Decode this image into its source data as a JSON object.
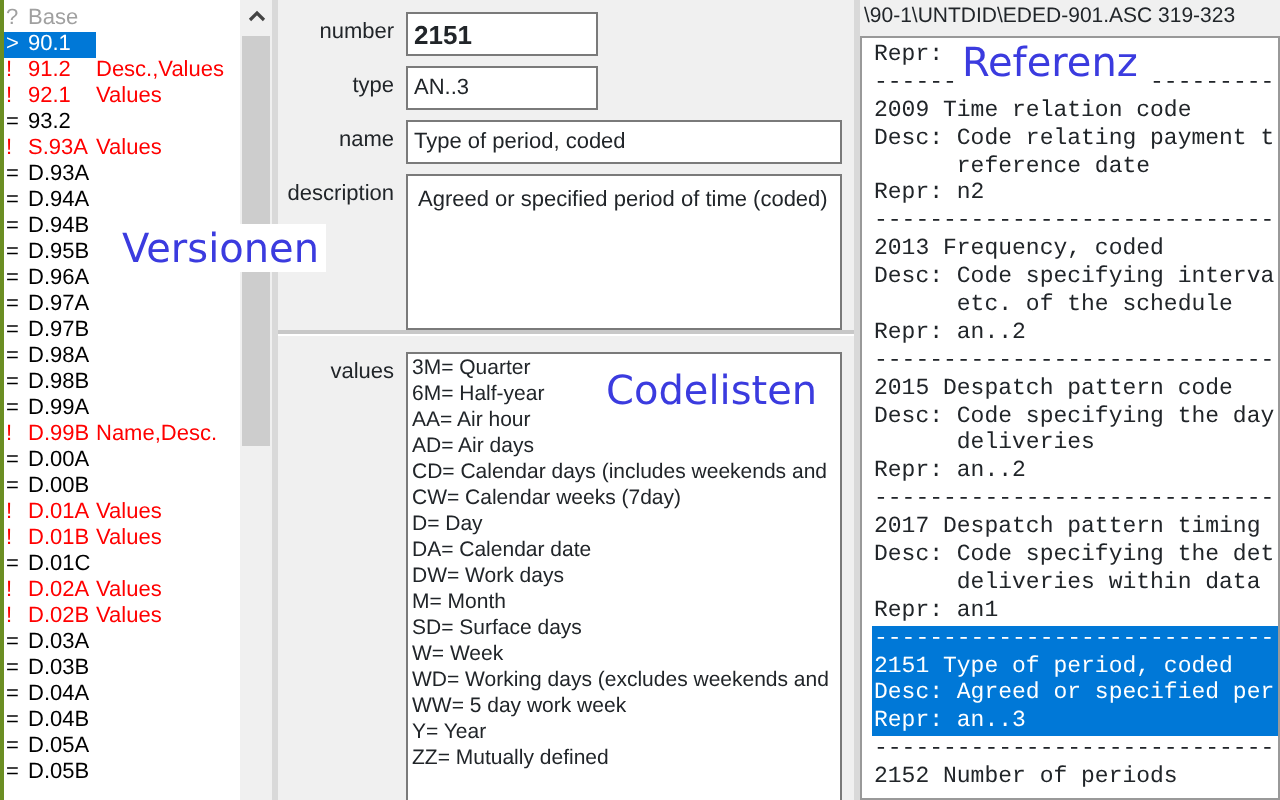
{
  "versions": {
    "items": [
      {
        "marker": "?",
        "version": "Base",
        "color": "#a0a0a0",
        "selected": false
      },
      {
        "marker": ">",
        "version": "90.1",
        "selected": true
      },
      {
        "marker": "!",
        "version": "91.2",
        "changes": "Desc.,Values",
        "color": "#ff0000",
        "selected": false
      },
      {
        "marker": "!",
        "version": "92.1",
        "changes": "Values",
        "color": "#ff0000",
        "selected": false
      },
      {
        "marker": "=",
        "version": "93.2",
        "color": "#000000",
        "selected": false
      },
      {
        "marker": "!",
        "version": "S.93A",
        "changes": "Values",
        "color": "#ff0000",
        "selected": false
      },
      {
        "marker": "=",
        "version": "D.93A",
        "color": "#000000",
        "selected": false
      },
      {
        "marker": "=",
        "version": "D.94A",
        "color": "#000000",
        "selected": false
      },
      {
        "marker": "=",
        "version": "D.94B",
        "color": "#000000",
        "selected": false
      },
      {
        "marker": "=",
        "version": "D.95B",
        "color": "#000000",
        "selected": false
      },
      {
        "marker": "=",
        "version": "D.96A",
        "color": "#000000",
        "selected": false
      },
      {
        "marker": "=",
        "version": "D.97A",
        "color": "#000000",
        "selected": false
      },
      {
        "marker": "=",
        "version": "D.97B",
        "color": "#000000",
        "selected": false
      },
      {
        "marker": "=",
        "version": "D.98A",
        "color": "#000000",
        "selected": false
      },
      {
        "marker": "=",
        "version": "D.98B",
        "color": "#000000",
        "selected": false
      },
      {
        "marker": "=",
        "version": "D.99A",
        "color": "#000000",
        "selected": false
      },
      {
        "marker": "!",
        "version": "D.99B",
        "changes": "Name,Desc.",
        "color": "#ff0000",
        "selected": false
      },
      {
        "marker": "=",
        "version": "D.00A",
        "color": "#000000",
        "selected": false
      },
      {
        "marker": "=",
        "version": "D.00B",
        "color": "#000000",
        "selected": false
      },
      {
        "marker": "!",
        "version": "D.01A",
        "changes": "Values",
        "color": "#ff0000",
        "selected": false
      },
      {
        "marker": "!",
        "version": "D.01B",
        "changes": "Values",
        "color": "#ff0000",
        "selected": false
      },
      {
        "marker": "=",
        "version": "D.01C",
        "color": "#000000",
        "selected": false
      },
      {
        "marker": "!",
        "version": "D.02A",
        "changes": "Values",
        "color": "#ff0000",
        "selected": false
      },
      {
        "marker": "!",
        "version": "D.02B",
        "changes": "Values",
        "color": "#ff0000",
        "selected": false
      },
      {
        "marker": "=",
        "version": "D.03A",
        "color": "#000000",
        "selected": false
      },
      {
        "marker": "=",
        "version": "D.03B",
        "color": "#000000",
        "selected": false
      },
      {
        "marker": "=",
        "version": "D.04A",
        "color": "#000000",
        "selected": false
      },
      {
        "marker": "=",
        "version": "D.04B",
        "color": "#000000",
        "selected": false
      },
      {
        "marker": "=",
        "version": "D.05A",
        "color": "#000000",
        "selected": false
      },
      {
        "marker": "=",
        "version": "D.05B",
        "color": "#000000",
        "selected": false
      }
    ],
    "annotation": "Versionen"
  },
  "form": {
    "fields": [
      {
        "label": "number",
        "value": "2151",
        "kind": "bold"
      },
      {
        "label": "type",
        "value": "AN..3",
        "kind": "short"
      },
      {
        "label": "name",
        "value": "Type of period, coded",
        "kind": "wide"
      },
      {
        "label": "description",
        "value": "Agreed or specified period of time (coded)",
        "kind": "area"
      }
    ]
  },
  "values": {
    "label": "values",
    "annotation": "Codelisten",
    "lines": [
      "3M= Quarter",
      "6M= Half-year",
      "AA= Air hour",
      "AD= Air days",
      "CD= Calendar days (includes weekends and",
      "CW= Calendar weeks (7day)",
      "D= Day",
      "DA= Calendar date",
      "DW= Work days",
      "M= Month",
      "SD= Surface days",
      "W= Week",
      "WD= Working days (excludes weekends and",
      "WW= 5 day work week",
      "Y= Year",
      "ZZ= Mutually defined"
    ]
  },
  "reference": {
    "path": "\\90-1\\UNTDID\\EDED-901.ASC  319-323",
    "annotation": "Referenz",
    "lines": [
      {
        "text": "Repr:",
        "selected": false
      },
      {
        "text": "------",
        "after": "---------",
        "selected": false
      },
      {
        "text": "2009 Time relation code",
        "selected": false
      },
      {
        "text": "Desc: Code relating payment t",
        "selected": false
      },
      {
        "text": "      reference date",
        "selected": false
      },
      {
        "text": "Repr: n2",
        "selected": false
      },
      {
        "text": "-----------------------------",
        "selected": false
      },
      {
        "text": "2013 Frequency, coded",
        "selected": false
      },
      {
        "text": "Desc: Code specifying interva",
        "selected": false
      },
      {
        "text": "      etc. of the schedule",
        "selected": false
      },
      {
        "text": "Repr: an..2",
        "selected": false
      },
      {
        "text": "-----------------------------",
        "selected": false
      },
      {
        "text": "2015 Despatch pattern code",
        "selected": false
      },
      {
        "text": "Desc: Code specifying the day",
        "selected": false
      },
      {
        "text": "      deliveries",
        "selected": false
      },
      {
        "text": "Repr: an..2",
        "selected": false
      },
      {
        "text": "-----------------------------",
        "selected": false
      },
      {
        "text": "2017 Despatch pattern timing",
        "selected": false
      },
      {
        "text": "Desc: Code specifying the det",
        "selected": false
      },
      {
        "text": "      deliveries within data",
        "selected": false
      },
      {
        "text": "Repr: an1",
        "selected": false
      },
      {
        "text": "-----------------------------",
        "selected": true
      },
      {
        "text": "2151 Type of period, coded",
        "selected": true
      },
      {
        "text": "Desc: Agreed or specified per",
        "selected": true
      },
      {
        "text": "Repr: an..3",
        "selected": true
      },
      {
        "text": "-----------------------------",
        "selected": false
      },
      {
        "text": "2152 Number of periods",
        "selected": false
      }
    ]
  }
}
